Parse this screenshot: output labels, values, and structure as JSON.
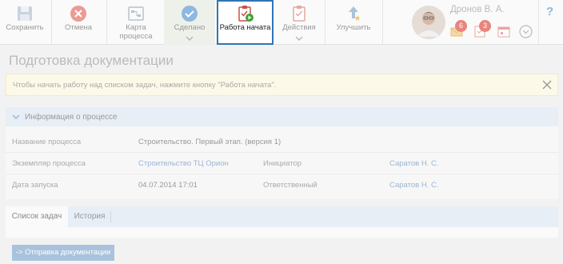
{
  "toolbar": {
    "save": "Сохранить",
    "cancel": "Отмена",
    "map": "Карта процесса",
    "done": "Сделано",
    "work_started": "Работа начата",
    "actions": "Действия",
    "improve": "Улучшить"
  },
  "user": {
    "name": "Дронов В. А.",
    "badge_messages": "6",
    "badge_tasks": "3"
  },
  "help": "?",
  "page_title": "Подготовка документации",
  "notice": {
    "text": "Чтобы начать работу над списком задач, нажмите кнопку \"Работа начата\"."
  },
  "info_panel": {
    "title": "Информация о процессе",
    "rows": [
      {
        "label": "Название процесса",
        "value": "Строительство. Первый этап. (версия 1)"
      },
      {
        "label": "Экземпляр процесса",
        "value": "Строительство ТЦ Орион",
        "label2": "Инициатор",
        "value2": "Саратов Н. С."
      },
      {
        "label": "Дата запуска",
        "value": "04.07.2014 17:01",
        "label2": "Ответственный",
        "value2": "Саратов Н. С."
      }
    ]
  },
  "tabs": [
    "Список задач",
    "История"
  ],
  "send_button": "-> Отправка документации",
  "colors": {
    "accent": "#2e75b5",
    "cancel_red": "#e9847d",
    "done_blue": "#8fb8e0",
    "link": "#9ab5d6"
  }
}
